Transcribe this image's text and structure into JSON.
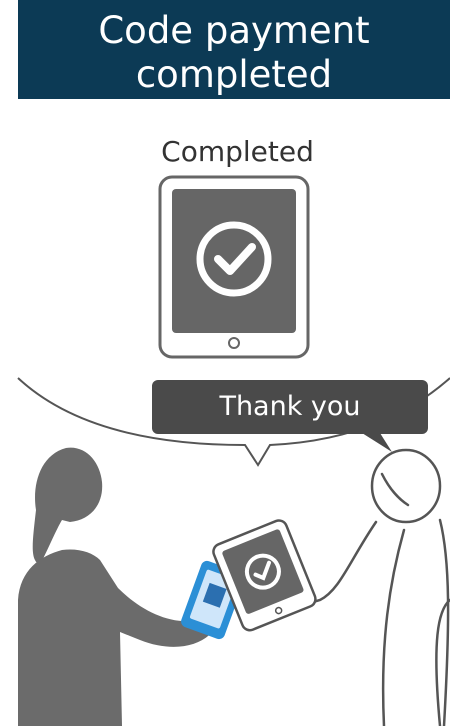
{
  "header": {
    "title_line1": "Code payment",
    "title_line2": "completed"
  },
  "screen": {
    "status_label": "Completed"
  },
  "speech_bubble": {
    "text": "Thank you"
  },
  "colors": {
    "header_bg": "#0c3a55",
    "figure": "#6b6b6b",
    "bubble": "#4a4a4a",
    "phone_accent": "#2b8fd6"
  }
}
